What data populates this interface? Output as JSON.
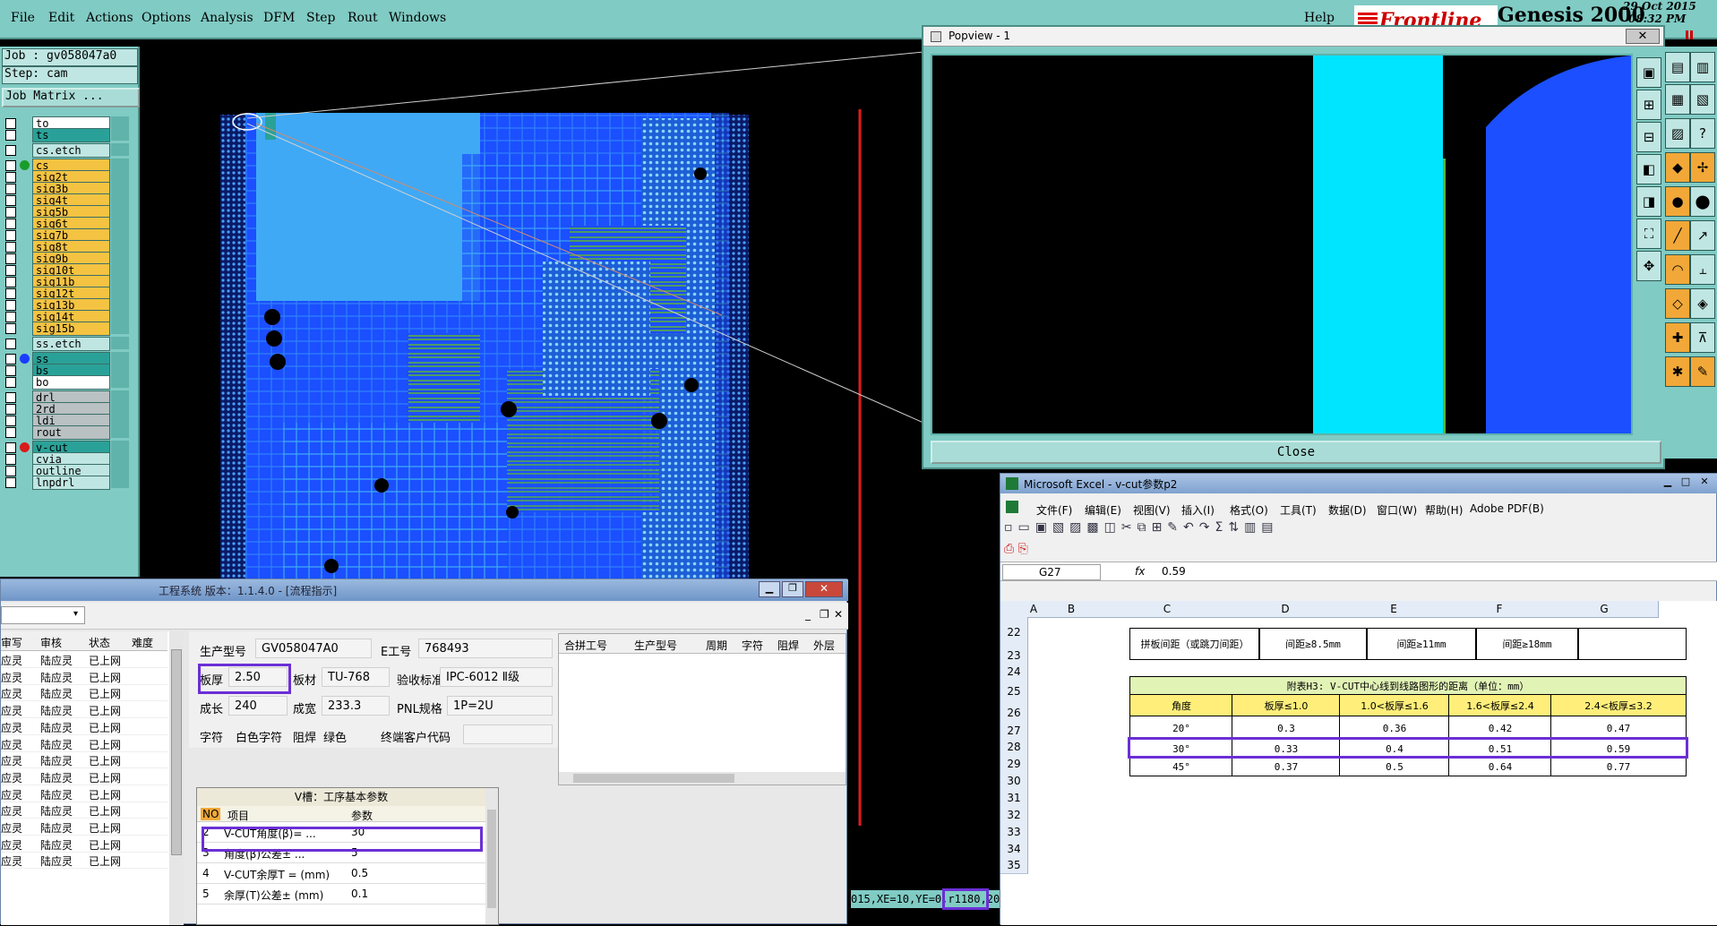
{
  "menubar": {
    "items": [
      "File",
      "Edit",
      "Actions",
      "Options",
      "Analysis",
      "DFM",
      "Step",
      "Rout",
      "Windows"
    ],
    "help": "Help",
    "brand": "Frontline",
    "product": "Genesis 2000",
    "date": "29 Oct 2015",
    "time": "08:32 PM"
  },
  "left_panel": {
    "job": "Job : gv058047a0",
    "step": "Step: cam",
    "job_matrix": "Job Matrix ...",
    "layers": [
      {
        "name": "to",
        "color": "#ffffff"
      },
      {
        "name": "ts",
        "color": "#2aa198"
      },
      {
        "name": "cs.etch",
        "color": "#bfe6e2"
      },
      {
        "name": "cs",
        "color": "#f5c342",
        "marker": "#1a9c2a"
      },
      {
        "name": "sig2t",
        "color": "#f5c342"
      },
      {
        "name": "sig3b",
        "color": "#f5c342"
      },
      {
        "name": "sig4t",
        "color": "#f5c342"
      },
      {
        "name": "sig5b",
        "color": "#f5c342"
      },
      {
        "name": "sig6t",
        "color": "#f5c342"
      },
      {
        "name": "sig7b",
        "color": "#f5c342"
      },
      {
        "name": "sig8t",
        "color": "#f5c342"
      },
      {
        "name": "sig9b",
        "color": "#f5c342"
      },
      {
        "name": "sig10t",
        "color": "#f5c342"
      },
      {
        "name": "sig11b",
        "color": "#f5c342"
      },
      {
        "name": "sig12t",
        "color": "#f5c342"
      },
      {
        "name": "sig13b",
        "color": "#f5c342"
      },
      {
        "name": "sig14t",
        "color": "#f5c342"
      },
      {
        "name": "sig15b",
        "color": "#f5c342"
      },
      {
        "name": "ss.etch",
        "color": "#bfe6e2"
      },
      {
        "name": "ss",
        "color": "#2aa198",
        "marker": "#1b3cff"
      },
      {
        "name": "bs",
        "color": "#2aa198"
      },
      {
        "name": "bo",
        "color": "#ffffff"
      },
      {
        "name": "drl",
        "color": "#b9c1c3"
      },
      {
        "name": "2rd",
        "color": "#b9c1c3"
      },
      {
        "name": "ldi",
        "color": "#b9c1c3"
      },
      {
        "name": "rout",
        "color": "#b9c1c3"
      },
      {
        "name": "v-cut",
        "color": "#2aa198",
        "marker": "#d81b1b"
      },
      {
        "name": "cvia",
        "color": "#bfe6e2"
      },
      {
        "name": "outline",
        "color": "#bfe6e2"
      },
      {
        "name": "lnpdrl",
        "color": "#bfe6e2"
      }
    ]
  },
  "popview": {
    "title": "Popview - 1",
    "close": "Close"
  },
  "status_strip": "015,XE=10,YE=0,r1180,20",
  "excel": {
    "title": "Microsoft Excel - v-cut参数p2",
    "menu": [
      "文件(F)",
      "编辑(E)",
      "视图(V)",
      "插入(I)",
      "格式(O)",
      "工具(T)",
      "数据(D)",
      "窗口(W)",
      "帮助(H)",
      "Adobe PDF(B)"
    ],
    "name_box": "G27",
    "fx": "fx",
    "formula": "0.59",
    "columns": [
      "A",
      "B",
      "C",
      "D",
      "E",
      "F",
      "G"
    ],
    "rows": [
      "22",
      "23",
      "24",
      "25",
      "26",
      "27",
      "28",
      "29",
      "30",
      "31",
      "32",
      "33",
      "34",
      "35"
    ],
    "row22": [
      "拼板间距（或跳刀间距）",
      "间距≥8.5mm",
      "间距≥11mm",
      "间距≥18mm",
      ""
    ],
    "table_title": "附表H3: V-CUT中心线到线路图形的距离（单位：mm）",
    "table_header": [
      "角度",
      "板厚≤1.0",
      "1.0<板厚≤1.6",
      "1.6<板厚≤2.4",
      "2.4<板厚≤3.2"
    ],
    "table_rows": [
      [
        "20°",
        "0.3",
        "0.36",
        "0.42",
        "0.47"
      ],
      [
        "30°",
        "0.33",
        "0.4",
        "0.51",
        "0.59"
      ],
      [
        "45°",
        "0.37",
        "0.5",
        "0.64",
        "0.77"
      ]
    ]
  },
  "eng": {
    "title": "工程系统   版本：1.1.4.0 - [流程指示]",
    "left_headers": [
      "审写",
      "审核",
      "状态",
      "难度"
    ],
    "left_rows": [
      [
        "应灵",
        "陆应灵",
        "已上网"
      ],
      [
        "应灵",
        "陆应灵",
        "已上网"
      ],
      [
        "应灵",
        "陆应灵",
        "已上网"
      ],
      [
        "应灵",
        "陆应灵",
        "已上网"
      ],
      [
        "应灵",
        "陆应灵",
        "已上网"
      ],
      [
        "应灵",
        "陆应灵",
        "已上网"
      ],
      [
        "应灵",
        "陆应灵",
        "已上网"
      ],
      [
        "应灵",
        "陆应灵",
        "已上网"
      ],
      [
        "应灵",
        "陆应灵",
        "已上网"
      ],
      [
        "应灵",
        "陆应灵",
        "已上网"
      ],
      [
        "应灵",
        "陆应灵",
        "已上网"
      ],
      [
        "应灵",
        "陆应灵",
        "已上网"
      ],
      [
        "应灵",
        "陆应灵",
        "已上网"
      ]
    ],
    "fields": {
      "model_label": "生产型号",
      "model": "GV058047A0",
      "eno_label": "E工号",
      "eno": "768493",
      "thick_label": "板厚",
      "thick": "2.50",
      "material_label": "板材",
      "material": "TU-768",
      "std_label": "验收标准",
      "std": "IPC-6012 Ⅱ级",
      "len_label": "成长",
      "len": "240",
      "wid_label": "成宽",
      "wid": "233.3",
      "pnl_label": "PNL规格",
      "pnl": "1P=2U",
      "char_label": "字符",
      "char": "白色字符",
      "mask_label": "阻焊",
      "mask": "绿色",
      "cust_label": "终端客户代码",
      "cust": ""
    },
    "right_headers": [
      "合拼工号",
      "生产型号",
      "周期",
      "字符",
      "阻焊",
      "外层"
    ],
    "vgroove_title": "V槽：工序基本参数",
    "vgroove_headers": [
      "NO",
      "项目",
      "参数"
    ],
    "vgroove_rows": [
      [
        "2",
        "V-CUT角度(β)=   ...",
        "30"
      ],
      [
        "3",
        "角度(β)公差±   ...",
        "5"
      ],
      [
        "4",
        "V-CUT余厚T =  (mm)",
        "0.5"
      ],
      [
        "5",
        "余厚(T)公差±  (mm)",
        "0.1"
      ]
    ]
  }
}
